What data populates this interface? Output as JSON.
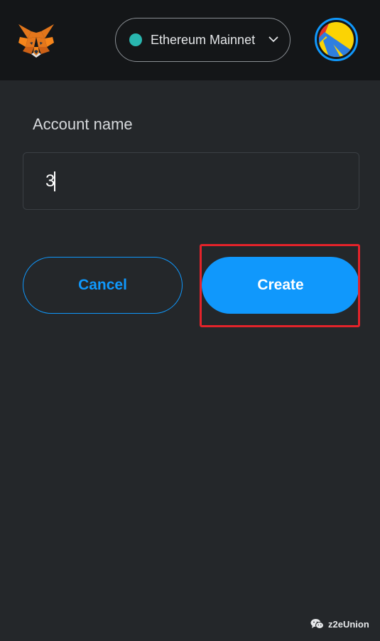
{
  "header": {
    "logo_icon": "metamask-fox-icon",
    "network": {
      "label": "Ethereum Mainnet",
      "dot_color": "#29b6af",
      "dropdown_icon": "chevron-down-icon"
    },
    "account_icon": "account-identicon-icon"
  },
  "form": {
    "label": "Account name",
    "input_value": "3"
  },
  "actions": {
    "cancel_label": "Cancel",
    "create_label": "Create"
  },
  "annotation": {
    "highlight_color": "#e3232a"
  },
  "watermark": {
    "icon": "wechat-icon",
    "text": "z2eUnion"
  },
  "colors": {
    "accent": "#1098fc",
    "background": "#24272a",
    "header_background": "#141618"
  }
}
